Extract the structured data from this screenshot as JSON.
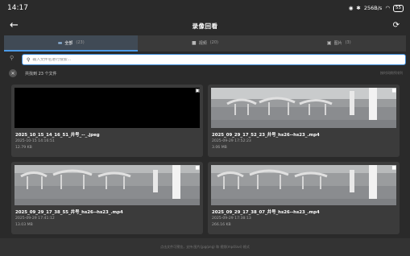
{
  "status_bar": {
    "time": "14:17",
    "network_speed": "256B/s",
    "battery": "55"
  },
  "header": {
    "title": "录像回看"
  },
  "tabs": [
    {
      "label": "全部",
      "count": "(23)",
      "icon": "folder-icon",
      "active": true
    },
    {
      "label": "视频",
      "count": "(20)",
      "icon": "video-icon",
      "active": false
    },
    {
      "label": "图片",
      "count": "(3)",
      "icon": "image-icon",
      "active": false
    }
  ],
  "search": {
    "placeholder": "输入文件名进行搜索..."
  },
  "summary": {
    "count_text": "共找到 23 个文件",
    "hint": "按时间倒序排列"
  },
  "files": [
    {
      "name": "2025_10_15_14_16_51_井号_--_.jpeg",
      "date": "2025-10-15 14:16:51",
      "size": "12.79 KB",
      "type": "image",
      "thumb": "black"
    },
    {
      "name": "2025_09_29_17_52_23_井号_hs26--hs23_.mp4",
      "date": "2025-09-29 17:52:23",
      "size": "3.06 MB",
      "type": "video",
      "thumb": "scene"
    },
    {
      "name": "2025_09_29_17_38_55_井号_hs26--hs23_.mp4",
      "date": "2025-09-29 17:41:12",
      "size": "13.03 MB",
      "type": "video",
      "thumb": "scene"
    },
    {
      "name": "2025_09_29_17_38_07_井号_hs26--hs23_.mp4",
      "date": "2025-09-29 17:38:13",
      "size": "266.16 KB",
      "type": "video",
      "thumb": "scene"
    }
  ],
  "footer": {
    "text": "点击文件可预览，支持 图片(jpg/png) 和 视频(mp4/avi) 格式"
  }
}
